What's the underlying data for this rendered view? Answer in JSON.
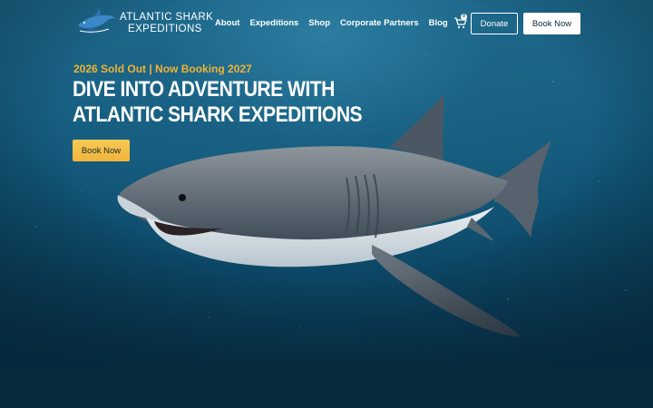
{
  "brand": {
    "line1": "ATLANTIC SHARK",
    "line2": "EXPEDITIONS"
  },
  "nav": {
    "items": [
      {
        "label": "About"
      },
      {
        "label": "Expeditions"
      },
      {
        "label": "Shop"
      },
      {
        "label": "Corporate Partners"
      },
      {
        "label": "Blog"
      }
    ]
  },
  "header": {
    "cart_icon": "shopping-cart-icon",
    "cart_count": "0",
    "donate_label": "Donate",
    "book_label": "Book Now"
  },
  "hero": {
    "tagline": "2026 Sold Out | Now Booking 2027",
    "headline_line1": "DIVE INTO ADVENTURE WITH",
    "headline_line2": "ATLANTIC SHARK EXPEDITIONS",
    "cta_label": "Book Now",
    "image": "great-white-shark-underwater"
  },
  "colors": {
    "accent": "#f2b233",
    "ocean": "#135a7c",
    "footer_band": "#072a3c"
  }
}
